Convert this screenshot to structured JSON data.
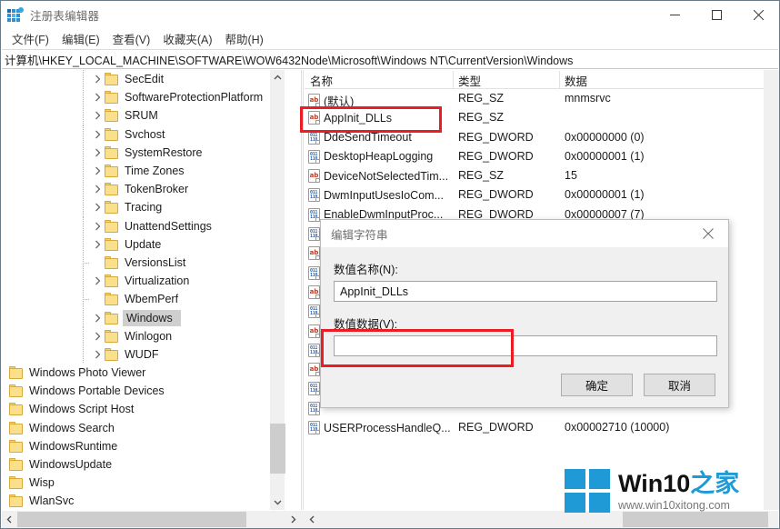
{
  "window": {
    "title": "注册表编辑器",
    "icon": "registry-editor-icon",
    "minimize": "—",
    "maximize": "□",
    "close": "✕"
  },
  "menubar": {
    "items": [
      {
        "label": "文件(F)",
        "name": "menu-file"
      },
      {
        "label": "编辑(E)",
        "name": "menu-edit"
      },
      {
        "label": "查看(V)",
        "name": "menu-view"
      },
      {
        "label": "收藏夹(A)",
        "name": "menu-favorites"
      },
      {
        "label": "帮助(H)",
        "name": "menu-help"
      }
    ]
  },
  "address": {
    "path": "计算机\\HKEY_LOCAL_MACHINE\\SOFTWARE\\WOW6432Node\\Microsoft\\Windows NT\\CurrentVersion\\Windows"
  },
  "tree": {
    "nodes": [
      {
        "label": "SecEdit",
        "level": 1,
        "expandable": true,
        "selected": false
      },
      {
        "label": "SoftwareProtectionPlatform",
        "level": 1,
        "expandable": true,
        "selected": false
      },
      {
        "label": "SRUM",
        "level": 1,
        "expandable": true,
        "selected": false
      },
      {
        "label": "Svchost",
        "level": 1,
        "expandable": true,
        "selected": false
      },
      {
        "label": "SystemRestore",
        "level": 1,
        "expandable": true,
        "selected": false
      },
      {
        "label": "Time Zones",
        "level": 1,
        "expandable": true,
        "selected": false
      },
      {
        "label": "TokenBroker",
        "level": 1,
        "expandable": true,
        "selected": false
      },
      {
        "label": "Tracing",
        "level": 1,
        "expandable": true,
        "selected": false
      },
      {
        "label": "UnattendSettings",
        "level": 1,
        "expandable": true,
        "selected": false
      },
      {
        "label": "Update",
        "level": 1,
        "expandable": true,
        "selected": false
      },
      {
        "label": "VersionsList",
        "level": 1,
        "expandable": false,
        "selected": false
      },
      {
        "label": "Virtualization",
        "level": 1,
        "expandable": true,
        "selected": false
      },
      {
        "label": "WbemPerf",
        "level": 1,
        "expandable": false,
        "selected": false
      },
      {
        "label": "Windows",
        "level": 1,
        "expandable": true,
        "selected": true
      },
      {
        "label": "Winlogon",
        "level": 1,
        "expandable": true,
        "selected": false
      },
      {
        "label": "WUDF",
        "level": 1,
        "expandable": true,
        "selected": false
      },
      {
        "label": "Windows Photo Viewer",
        "level": 0,
        "expandable": false,
        "selected": false
      },
      {
        "label": "Windows Portable Devices",
        "level": 0,
        "expandable": false,
        "selected": false
      },
      {
        "label": "Windows Script Host",
        "level": 0,
        "expandable": false,
        "selected": false
      },
      {
        "label": "Windows Search",
        "level": 0,
        "expandable": false,
        "selected": false
      },
      {
        "label": "WindowsRuntime",
        "level": 0,
        "expandable": false,
        "selected": false
      },
      {
        "label": "WindowsUpdate",
        "level": 0,
        "expandable": false,
        "selected": false
      },
      {
        "label": "Wisp",
        "level": 0,
        "expandable": false,
        "selected": false
      },
      {
        "label": "WlanSvc",
        "level": 0,
        "expandable": false,
        "selected": false
      }
    ]
  },
  "list": {
    "columns": [
      "名称",
      "类型",
      "数据"
    ],
    "rows": [
      {
        "name": "(默认)",
        "type": "REG_SZ",
        "data": "mnmsrvc",
        "icon": "string-value-icon"
      },
      {
        "name": "AppInit_DLLs",
        "type": "REG_SZ",
        "data": "",
        "icon": "string-value-icon"
      },
      {
        "name": "DdeSendTimeout",
        "type": "REG_DWORD",
        "data": "0x00000000 (0)",
        "icon": "dword-value-icon"
      },
      {
        "name": "DesktopHeapLogging",
        "type": "REG_DWORD",
        "data": "0x00000001 (1)",
        "icon": "dword-value-icon"
      },
      {
        "name": "DeviceNotSelectedTim...",
        "type": "REG_SZ",
        "data": "15",
        "icon": "string-value-icon"
      },
      {
        "name": "DwmInputUsesIoCom...",
        "type": "REG_DWORD",
        "data": "0x00000001 (1)",
        "icon": "dword-value-icon"
      },
      {
        "name": "EnableDwmInputProc...",
        "type": "REG_DWORD",
        "data": "0x00000007 (7)",
        "icon": "dword-value-icon"
      }
    ],
    "hidden_rows": [
      {
        "icon": "dword-value-icon"
      },
      {
        "icon": "string-value-icon"
      },
      {
        "icon": "dword-value-icon"
      },
      {
        "icon": "string-value-icon"
      },
      {
        "icon": "dword-value-icon"
      },
      {
        "icon": "string-value-icon"
      },
      {
        "icon": "dword-value-icon"
      },
      {
        "icon": "string-value-icon"
      },
      {
        "icon": "dword-value-icon"
      },
      {
        "icon": "dword-value-icon"
      }
    ],
    "last_row": {
      "name": "USERProcessHandleQ...",
      "type": "REG_DWORD",
      "data": "0x00002710 (10000)",
      "icon": "dword-value-icon"
    }
  },
  "dialog": {
    "title": "编辑字符串",
    "close": "✕",
    "name_label": "数值名称(N):",
    "name_value": "AppInit_DLLs",
    "data_label": "数值数据(V):",
    "data_value": "",
    "ok": "确定",
    "cancel": "取消"
  },
  "watermark": {
    "brand_en": "Win10",
    "brand_cn": "之家",
    "url": "www.win10xitong.com",
    "logo_color": "#1f9ad6"
  },
  "annotations": {
    "highlight_color": "#ec1c24",
    "boxes": [
      "appinit-dlls-row",
      "value-data-field"
    ]
  }
}
